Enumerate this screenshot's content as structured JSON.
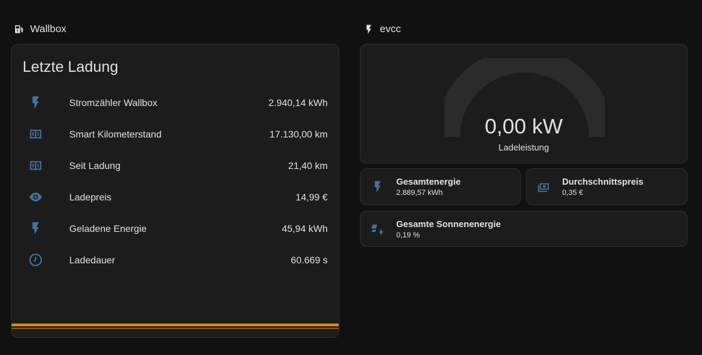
{
  "sections": {
    "wallbox": {
      "title": "Wallbox",
      "icon": "ev-station-icon"
    },
    "evcc": {
      "title": "evcc",
      "icon": "flash-icon"
    }
  },
  "wallbox_card": {
    "title": "Letzte Ladung",
    "rows": [
      {
        "icon": "flash-icon",
        "name": "Stromzähler Wallbox",
        "value": "2.940,14 kWh"
      },
      {
        "icon": "counter-icon",
        "name": "Smart Kilometerstand",
        "value": "17.130,00 km"
      },
      {
        "icon": "counter-icon",
        "name": "Seit Ladung",
        "value": "21,40 km"
      },
      {
        "icon": "eye-icon",
        "name": "Ladepreis",
        "value": "14,99 €"
      },
      {
        "icon": "flash-icon",
        "name": "Geladene Energie",
        "value": "45,94 kWh"
      },
      {
        "icon": "clock-icon",
        "name": "Ladedauer",
        "value": "60.669 s"
      }
    ],
    "accent_color": "#d98a15"
  },
  "gauge": {
    "value": "0,00 kW",
    "label": "Ladeleistung",
    "fraction": 0
  },
  "tiles": {
    "gesamtenergie": {
      "icon": "flash-icon",
      "name": "Gesamtenergie",
      "state": "2.889,57 kWh"
    },
    "durchschnittspreis": {
      "icon": "cash-icon",
      "name": "Durchschnittspreis",
      "state": "0,35 €"
    },
    "sonnenenergie": {
      "icon": "solar-power-icon",
      "name": "Gesamte Sonnenenergie",
      "state": "0,19 %"
    }
  },
  "colors": {
    "background": "#111111",
    "card": "#1c1c1c",
    "icon": "#44739e",
    "gauge_track": "#2b2b2b"
  }
}
